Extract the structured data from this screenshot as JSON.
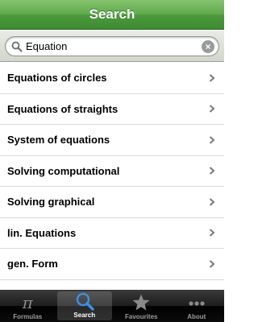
{
  "navbar": {
    "title": "Search"
  },
  "search": {
    "value": "Equation",
    "clear_icon": "clear-icon"
  },
  "results": [
    {
      "label": "Equations of circles"
    },
    {
      "label": "Equations of straights"
    },
    {
      "label": "System of equations"
    },
    {
      "label": "Solving computational"
    },
    {
      "label": "Solving graphical"
    },
    {
      "label": "lin. Equations"
    },
    {
      "label": "gen. Form"
    }
  ],
  "tabs": [
    {
      "label": "Formulas",
      "icon": "pi-icon",
      "active": false
    },
    {
      "label": "Search",
      "icon": "search-icon",
      "active": true
    },
    {
      "label": "Favourites",
      "icon": "star-icon",
      "active": false
    },
    {
      "label": "About",
      "icon": "more-icon",
      "active": false
    }
  ],
  "colors": {
    "navbar": "#4d9a3d",
    "tabbar": "#000000",
    "chevron": "#7a7a7a"
  }
}
